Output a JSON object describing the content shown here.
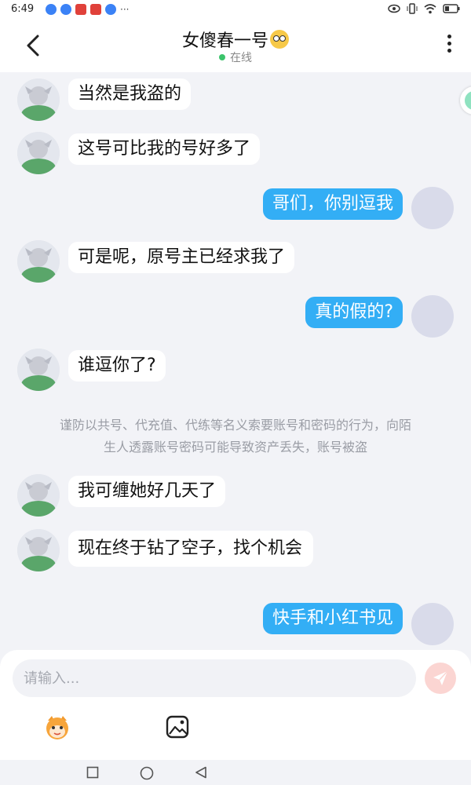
{
  "status_bar": {
    "time": "6:49",
    "dots": "···",
    "battery_icon": "battery-icon"
  },
  "header": {
    "title": "女傻春一号",
    "title_emoji": "eye-roll-emoji",
    "status": "在线"
  },
  "messages": [
    {
      "side": "in",
      "text": "当然是我盗的"
    },
    {
      "side": "in",
      "text": "这号可比我的号好多了"
    },
    {
      "side": "out",
      "text": "哥们，你别逗我"
    },
    {
      "side": "in",
      "text": "可是呢，原号主已经求我了"
    },
    {
      "side": "out",
      "text": "真的假的?"
    },
    {
      "side": "in",
      "text": "谁逗你了?"
    },
    {
      "side": "in",
      "text": "我可缠她好几天了"
    },
    {
      "side": "in",
      "text": "现在终于钻了空子，找个机会"
    },
    {
      "side": "out",
      "text": "快手和小红书见"
    }
  ],
  "notice": {
    "line1": "谨防以共号、代充值、代练等名义索要账号和密码的行为，向陌",
    "line2": "生人透露账号密码可能导致资产丢失，账号被盗"
  },
  "input": {
    "placeholder": "请输入..."
  },
  "icons": {
    "back": "back-arrow-icon",
    "more": "more-vertical-icon",
    "send": "send-icon",
    "emoji": "mascot-emoji-icon",
    "image": "image-icon"
  },
  "colors": {
    "outgoing_bubble": "#33aef5",
    "online_dot": "#3cc46b",
    "send_button": "#fbd5d2"
  }
}
